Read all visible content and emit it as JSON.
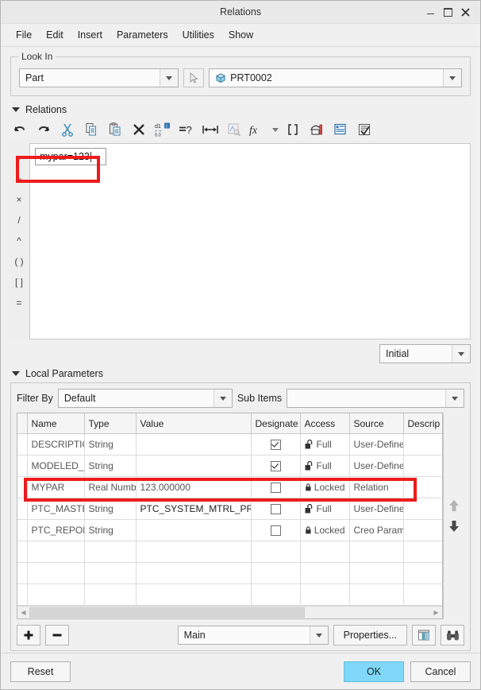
{
  "window": {
    "title": "Relations",
    "controls": {
      "minimize": "minimize-icon",
      "maximize": "maximize-icon",
      "close": "×"
    }
  },
  "menubar": {
    "items": [
      "File",
      "Edit",
      "Insert",
      "Parameters",
      "Utilities",
      "Show"
    ]
  },
  "look_in": {
    "legend": "Look In",
    "type_value": "Part",
    "select_icon": "pointer-arrow-icon",
    "object_icon": "part-cube-icon",
    "object_value": "PRT0002"
  },
  "relations": {
    "section_title": "Relations",
    "toolbar": [
      {
        "name": "undo-icon",
        "label": "Undo"
      },
      {
        "name": "redo-icon",
        "label": "Redo"
      },
      {
        "name": "cut-icon",
        "label": "Cut"
      },
      {
        "name": "copy-icon",
        "label": "Copy"
      },
      {
        "name": "paste-icon",
        "label": "Paste"
      },
      {
        "name": "delete-x-icon",
        "label": "Delete"
      },
      {
        "name": "insert-dimension-icon",
        "label": "Insert Dimension"
      },
      {
        "name": "verify-equals-icon",
        "label": "Verify Relations"
      },
      {
        "name": "measure-icon",
        "label": "Measure"
      },
      {
        "name": "switch-dimensions-icon",
        "label": "Switch Dimensions"
      },
      {
        "name": "function-fx-icon",
        "label": "Insert Function"
      },
      {
        "name": "brackets-icon",
        "label": "Insert Parameter"
      },
      {
        "name": "units-icon",
        "label": "Units"
      },
      {
        "name": "notes-icon",
        "label": "Relation Notes"
      },
      {
        "name": "check-list-icon",
        "label": "Verify"
      }
    ],
    "operators": [
      "+",
      "−",
      "×",
      "/",
      "^",
      "( )",
      "[ ]",
      "="
    ],
    "editor_text": "mypar=123",
    "initial_value": "Initial"
  },
  "local_parameters": {
    "section_title": "Local Parameters",
    "filter_by_label": "Filter By",
    "filter_by_value": "Default",
    "sub_items_label": "Sub Items",
    "sub_items_value": "",
    "columns": [
      "Name",
      "Type",
      "Value",
      "Designate",
      "Access",
      "Source",
      "Descrip"
    ],
    "rows": [
      {
        "name": "DESCRIPTIO",
        "type": "String",
        "value": "",
        "designate": true,
        "access": "Full",
        "access_icon": "unlocked-icon",
        "source": "User-Define",
        "description": ""
      },
      {
        "name": "MODELED_",
        "type": "String",
        "value": "",
        "designate": true,
        "access": "Full",
        "access_icon": "unlocked-icon",
        "source": "User-Define",
        "description": ""
      },
      {
        "name": "MYPAR",
        "type": "Real Numb",
        "value": "123.000000",
        "designate": false,
        "access": "Locked",
        "access_icon": "locked-icon",
        "source": "Relation",
        "description": ""
      },
      {
        "name": "PTC_MASTE",
        "type": "String",
        "value": "PTC_SYSTEM_MTRL_PROPS",
        "designate": false,
        "access": "Full",
        "access_icon": "unlocked-icon",
        "source": "User-Define",
        "description": ""
      },
      {
        "name": "PTC_REPOR",
        "type": "String",
        "value": "",
        "designate": false,
        "access": "Locked",
        "access_icon": "locked-icon",
        "source": "Creo Param",
        "description": ""
      }
    ],
    "move_up_icon": "move-up-arrow-icon",
    "move_down_icon": "move-down-arrow-icon",
    "add_label": "+",
    "remove_label": "−",
    "scope_value": "Main",
    "properties_label": "Properties...",
    "columns_icon": "table-columns-icon",
    "find_icon": "binoculars-icon"
  },
  "footer": {
    "reset": "Reset",
    "ok": "OK",
    "cancel": "Cancel"
  },
  "colors": {
    "accent": "#7fd8f7",
    "highlight_box": "#ee1b1b",
    "row_selection": "#bfe3f7",
    "window_bg": "#f0f0f0"
  }
}
